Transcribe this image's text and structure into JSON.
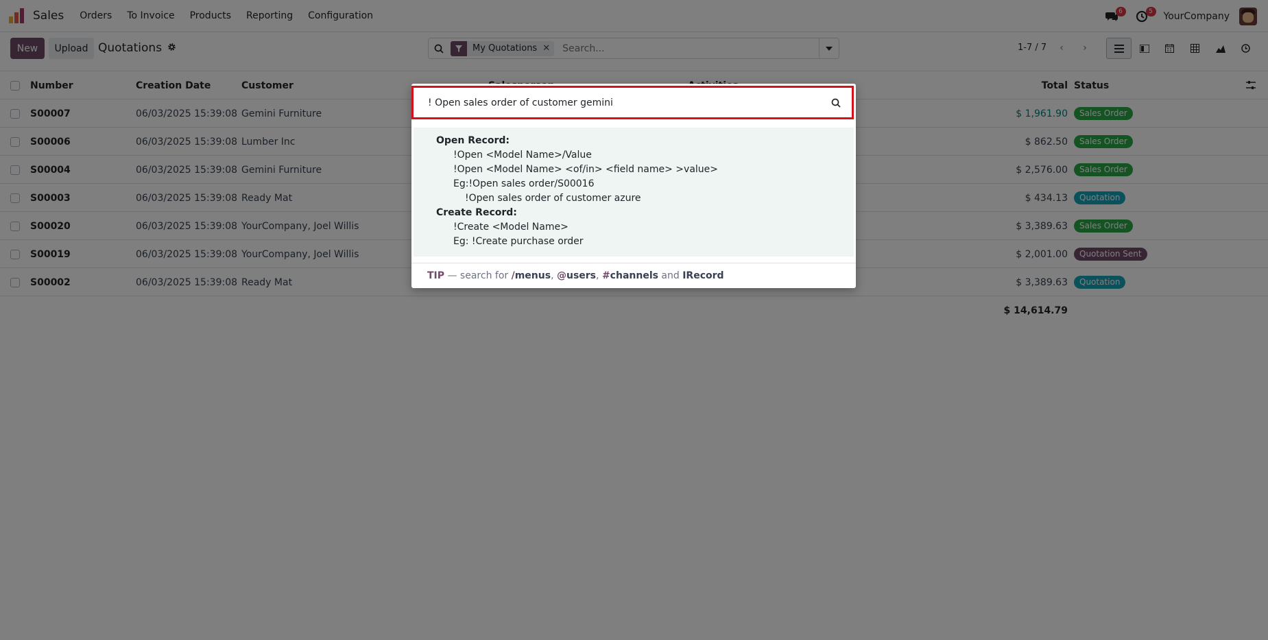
{
  "navbar": {
    "app_name": "Sales",
    "menu": [
      "Orders",
      "To Invoice",
      "Products",
      "Reporting",
      "Configuration"
    ],
    "messages_badge": "6",
    "activities_badge": "5",
    "company": "YourCompany"
  },
  "control": {
    "new_label": "New",
    "upload_label": "Upload",
    "title": "Quotations",
    "facet_label": "My Quotations",
    "search_placeholder": "Search...",
    "pager": "1-7 / 7"
  },
  "table": {
    "headers": {
      "number": "Number",
      "date": "Creation Date",
      "customer": "Customer",
      "salesperson": "Salesperson",
      "activities": "Activities",
      "total": "Total",
      "status": "Status"
    },
    "rows": [
      {
        "number": "S00007",
        "date": "06/03/2025 15:39:08",
        "customer": "Gemini Furniture",
        "total": "$ 1,961.90",
        "status": "Sales Order"
      },
      {
        "number": "S00006",
        "date": "06/03/2025 15:39:08",
        "customer": "Lumber Inc",
        "total": "$ 862.50",
        "status": "Sales Order"
      },
      {
        "number": "S00004",
        "date": "06/03/2025 15:39:08",
        "customer": "Gemini Furniture",
        "total": "$ 2,576.00",
        "status": "Sales Order"
      },
      {
        "number": "S00003",
        "date": "06/03/2025 15:39:08",
        "customer": "Ready Mat",
        "total": "$ 434.13",
        "status": "Quotation"
      },
      {
        "number": "S00020",
        "date": "06/03/2025 15:39:08",
        "customer": "YourCompany, Joel Willis",
        "total": "$ 3,389.63",
        "status": "Sales Order"
      },
      {
        "number": "S00019",
        "date": "06/03/2025 15:39:08",
        "customer": "YourCompany, Joel Willis",
        "total": "$ 2,001.00",
        "status": "Quotation Sent"
      },
      {
        "number": "S00002",
        "date": "06/03/2025 15:39:08",
        "customer": "Ready Mat",
        "total": "$ 3,389.63",
        "status": "Quotation"
      }
    ],
    "grand_total": "$ 14,614.79"
  },
  "palette": {
    "input_value": "! Open sales order of customer gemini",
    "help": {
      "open_record_title": "Open Record:",
      "open_line1": "!Open <Model Name>/Value",
      "open_line2": "!Open <Model Name> <of/in> <field name> >value>",
      "open_line3": "Eg:!Open sales order/S00016",
      "open_line4": "!Open sales order of customer azure",
      "create_record_title": "Create Record:",
      "create_line1": "!Create <Model Name>",
      "create_line2": "Eg: !Create purchase order"
    },
    "tip": {
      "tip_label": "TIP",
      "prefix": " — search for ",
      "menus_key": "/",
      "menus": "menus",
      "users_key": "@",
      "users": "users",
      "channels_key": "#",
      "channels": "channels",
      "and": " and ",
      "record": "IRecord"
    }
  },
  "colors": {
    "brand": "#714b67",
    "highlight_border": "#d3131c",
    "status_sales_order": "#28a745",
    "status_quotation": "#17a2b8",
    "status_quotation_sent": "#714b67"
  }
}
